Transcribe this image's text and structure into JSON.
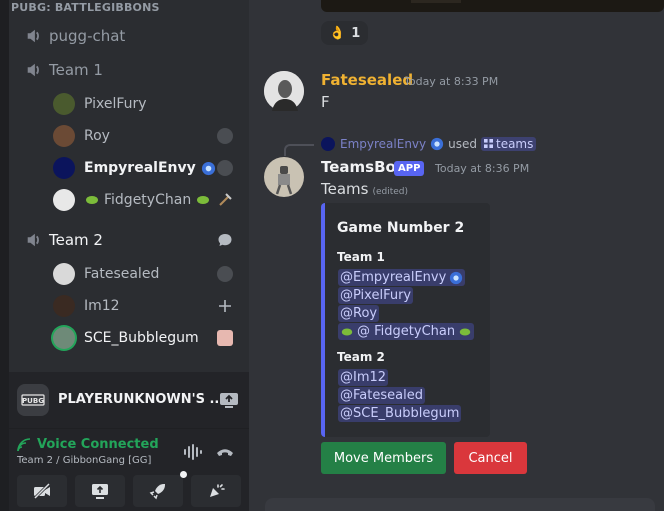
{
  "sidebar": {
    "category": "PUBG: BATTLEGIBBONS",
    "channels": [
      {
        "label": "pugg-chat"
      },
      {
        "label": "Team 1"
      },
      {
        "label": "Team 2"
      }
    ],
    "team1_users": [
      {
        "name": "PixelFury",
        "avatar_color": "#4a5a2e"
      },
      {
        "name": "Roy",
        "avatar_color": "#6b4a35"
      },
      {
        "name": "EmpyrealEnvy",
        "avatar_color": "#0b145c"
      },
      {
        "name": "FidgetyChan",
        "avatar_color": "#e8e8e8"
      }
    ],
    "team2_users": [
      {
        "name": "Fatesealed",
        "avatar_color": "#d9d9d9"
      },
      {
        "name": "Im12",
        "avatar_color": "#3a2a22"
      },
      {
        "name": "SCE_Bubblegum",
        "avatar_color": "#6e8a78",
        "ring_color": "#23a55a"
      }
    ]
  },
  "activity": {
    "title": "PLAYERUNKNOWN'S ...",
    "logo_text": "PUBG"
  },
  "voice": {
    "status": "Voice Connected",
    "subtitle": "Team 2 / GibbonGang [GG]",
    "status_color": "#23a55a"
  },
  "chat": {
    "reaction": {
      "emoji": "👌",
      "count": "1"
    },
    "message1": {
      "author": "Fatesealed",
      "author_color": "#f0b232",
      "timestamp": "Today at 8:33 PM",
      "text": "F"
    },
    "reply": {
      "user": "EmpyrealEnvy",
      "used": "used",
      "command": "teams"
    },
    "message2": {
      "author": "TeamsBot",
      "badge": "APP",
      "timestamp": "Today at 8:36 PM",
      "text": "Teams",
      "edited": "(edited)",
      "embed": {
        "title": "Game Number 2",
        "team1_heading": "Team 1",
        "team1": [
          "@EmpyrealEnvy",
          "@PixelFury",
          "@Roy",
          "@ FidgetyChan"
        ],
        "team2_heading": "Team 2",
        "team2": [
          "@Im12",
          "@Fatesealed",
          "@SCE_Bubblegum"
        ]
      },
      "buttons": {
        "move": "Move Members",
        "cancel": "Cancel"
      }
    }
  }
}
